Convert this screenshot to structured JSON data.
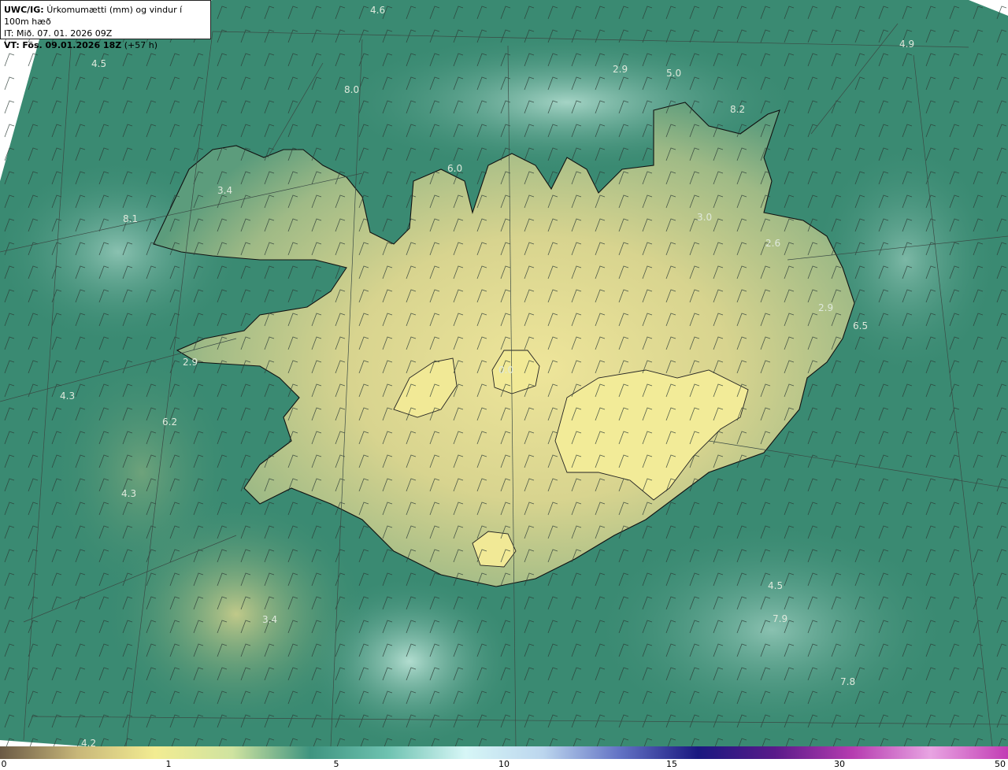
{
  "header": {
    "model_prefix": "UWC/IG:",
    "title": "Úrkomumætti (mm) og vindur í 100m hæð",
    "init_time": "IT: Mið. 07. 01. 2026 09Z",
    "valid_prefix": "VT:",
    "valid_time": "Fös. 09.01.2026 18Z",
    "lead": "(+57 h)"
  },
  "value_labels": [
    {
      "id": "v1",
      "text": "4.6"
    },
    {
      "id": "v2",
      "text": "4.9"
    },
    {
      "id": "v3",
      "text": "4.5"
    },
    {
      "id": "v4",
      "text": "8.0"
    },
    {
      "id": "v5",
      "text": "2.9"
    },
    {
      "id": "v6",
      "text": "5.0"
    },
    {
      "id": "v7",
      "text": "8.2"
    },
    {
      "id": "v8",
      "text": "6.0"
    },
    {
      "id": "v9",
      "text": "3.4"
    },
    {
      "id": "v10",
      "text": "8.1"
    },
    {
      "id": "v11",
      "text": "3.0"
    },
    {
      "id": "v12",
      "text": "2.6"
    },
    {
      "id": "v13",
      "text": "2.9"
    },
    {
      "id": "v14",
      "text": "6.5"
    },
    {
      "id": "v15",
      "text": "2.9"
    },
    {
      "id": "v16",
      "text": "0.0"
    },
    {
      "id": "v17",
      "text": "4.3"
    },
    {
      "id": "v18",
      "text": "6.2"
    },
    {
      "id": "v19",
      "text": "4.3"
    },
    {
      "id": "v20",
      "text": "4.5"
    },
    {
      "id": "v21",
      "text": "3.4"
    },
    {
      "id": "v22",
      "text": "7.9"
    },
    {
      "id": "v23",
      "text": "7.8"
    },
    {
      "id": "v24",
      "text": "4.2"
    }
  ],
  "colorbar": {
    "ticks": [
      "0",
      "1",
      "5",
      "10",
      "15",
      "30",
      "50"
    ],
    "colors": [
      "#6b5a45",
      "#c8b779",
      "#f2ec92",
      "#cfe3a0",
      "#3f9480",
      "#6ec2b0",
      "#d6f6f6",
      "#bcd6ee",
      "#6272c4",
      "#1a1880",
      "#5a1a8a",
      "#b63cb0",
      "#e8a4e2",
      "#c23cb4"
    ]
  },
  "colors": {
    "sea": "#3a8a72",
    "land_low": "#8fb08a",
    "land_high": "#e9e39a",
    "light_precip": "#a7d8cc",
    "coast": "#111111"
  }
}
